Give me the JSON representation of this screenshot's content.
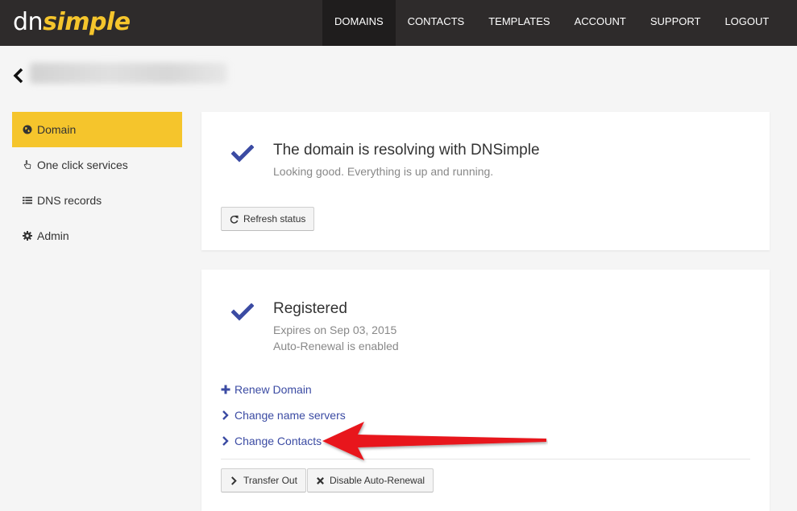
{
  "brand": {
    "logo_part1": "dn",
    "logo_part2": "simple",
    "accent": "#f5c52c"
  },
  "nav": {
    "items": [
      "DOMAINS",
      "CONTACTS",
      "TEMPLATES",
      "ACCOUNT",
      "SUPPORT",
      "LOGOUT"
    ],
    "active": "DOMAINS"
  },
  "sidebar": {
    "items": [
      {
        "label": "Domain",
        "icon": "globe-icon",
        "active": true
      },
      {
        "label": "One click services",
        "icon": "pointer-hand-icon"
      },
      {
        "label": "DNS records",
        "icon": "list-icon"
      },
      {
        "label": "Admin",
        "icon": "gear-icon"
      }
    ]
  },
  "resolving": {
    "title": "The domain is resolving with DNSimple",
    "subtitle": "Looking good. Everything is up and running.",
    "refresh_label": "Refresh status"
  },
  "registration": {
    "title": "Registered",
    "expires": "Expires on Sep 03, 2015",
    "auto_renewal": "Auto-Renewal is enabled",
    "links": [
      "Renew Domain",
      "Change name servers",
      "Change Contacts"
    ],
    "transfer_label": "Transfer Out",
    "disable_label": "Disable Auto-Renewal"
  },
  "colors": {
    "link": "#3b4ba3",
    "check": "#3b4ba3",
    "annotation_arrow": "#e8141b"
  }
}
